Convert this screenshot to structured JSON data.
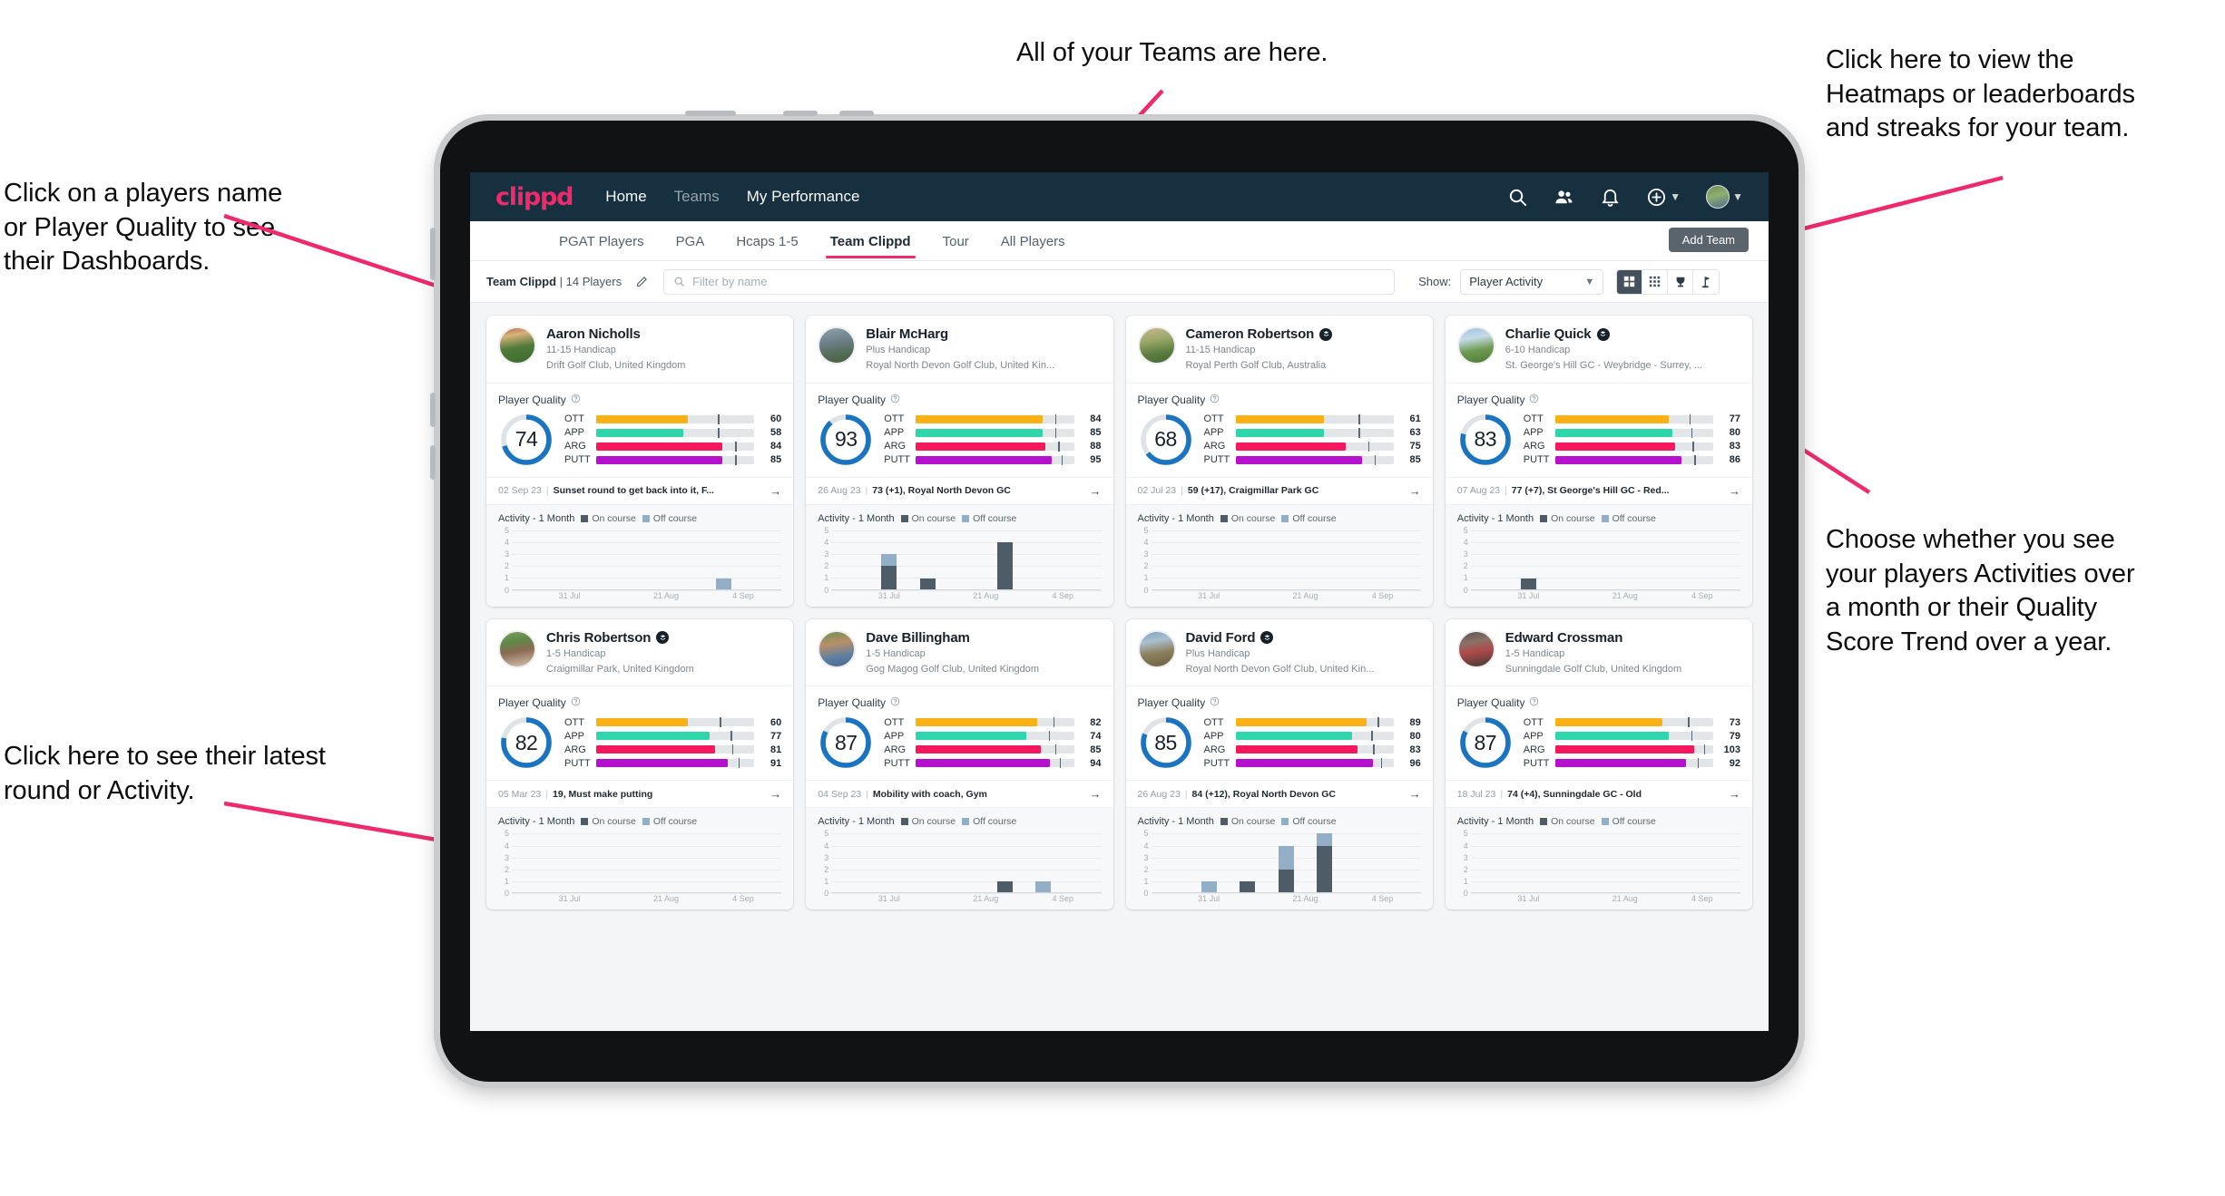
{
  "annotations": [
    {
      "id": "anno-teams",
      "text": "All of your Teams are here."
    },
    {
      "id": "anno-heatmaps",
      "text": "Click here to view the\nHeatmaps or leaderboards\nand streaks for your team."
    },
    {
      "id": "anno-player-name",
      "text": "Click on a players name\nor Player Quality to see\ntheir Dashboards."
    },
    {
      "id": "anno-activity-choice",
      "text": "Choose whether you see\nyour players Activities over\na month or their Quality\nScore Trend over a year."
    },
    {
      "id": "anno-latest-round",
      "text": "Click here to see their latest\nround or Activity."
    }
  ],
  "colors": {
    "brand_pink": "#ee2a6c",
    "navbar": "#17303f",
    "ring": "#1a74c0",
    "ott": "#f9b116",
    "app": "#30d6ab",
    "arg": "#f5records",
    "arg_real": "#f5185f",
    "putt": "#b410cd",
    "on_course": "#4e5c68",
    "off_course": "#93aec7"
  },
  "topnav": {
    "logo": "clippd",
    "links": [
      {
        "label": "Home",
        "active": true
      },
      {
        "label": "Teams",
        "active": false
      },
      {
        "label": "My Performance",
        "active": true
      }
    ],
    "icons": [
      {
        "name": "search-icon"
      },
      {
        "name": "people-icon"
      },
      {
        "name": "bell-icon"
      },
      {
        "name": "plus-circle-icon"
      }
    ],
    "avatar_name": "avatar"
  },
  "subtabs": {
    "items": [
      {
        "label": "PGAT Players",
        "active": false
      },
      {
        "label": "PGA",
        "active": false
      },
      {
        "label": "Hcaps 1-5",
        "active": false
      },
      {
        "label": "Team Clippd",
        "active": true
      },
      {
        "label": "Tour",
        "active": false
      },
      {
        "label": "All Players",
        "active": false
      }
    ],
    "add_team_label": "Add Team"
  },
  "filterbar": {
    "team_name": "Team Clippd",
    "team_count": "| 14 Players",
    "edit_icon": "pencil-icon",
    "search_placeholder": "Filter by name",
    "show_label": "Show:",
    "select_value": "Player Activity",
    "views": [
      {
        "name": "grid-2x2-view",
        "active": true
      },
      {
        "name": "grid-dense-view",
        "active": false
      },
      {
        "name": "trophy-view",
        "active": false
      },
      {
        "name": "flag-view",
        "active": false
      }
    ]
  },
  "card_labels": {
    "player_quality": "Player Quality",
    "activity": "Activity - 1 Month",
    "legend_on": "On course",
    "legend_off": "Off course",
    "metrics": [
      "OTT",
      "APP",
      "ARG",
      "PUTT"
    ]
  },
  "chart_data": {
    "type": "bar",
    "title": "Activity - 1 Month",
    "ylabel": "",
    "xlabel": "",
    "ylim": [
      0,
      5
    ],
    "yticks": [
      0,
      1,
      2,
      3,
      4,
      5
    ],
    "categories": [
      "31 Jul",
      "21 Aug",
      "4 Sep"
    ],
    "legend": [
      "On course",
      "Off course"
    ],
    "legend_position": "top",
    "grid": true,
    "note": "Each card shows a 7-slot stacked bar chart over the date axis 31 Jul / 21 Aug / 4 Sep; per-card values in players[].activity.bars as [on_course, off_course]."
  },
  "players": [
    {
      "name": "Aaron Nicholls",
      "verified": false,
      "handicap": "11-15 Handicap",
      "club": "Drift Golf Club, United Kingdom",
      "avatar": "linear-gradient(170deg,#b06a4e 0%,#d9b27a 22%,#4f7a3a 55%,#3d6b2e 100%)",
      "quality": 74,
      "metrics": [
        {
          "label": "OTT",
          "value": 60,
          "fill": 0.58,
          "tick": 0.77
        },
        {
          "label": "APP",
          "value": 58,
          "fill": 0.55,
          "tick": 0.77
        },
        {
          "label": "ARG",
          "value": 84,
          "fill": 0.8,
          "tick": 0.88
        },
        {
          "label": "PUTT",
          "value": 85,
          "fill": 0.8,
          "tick": 0.88
        }
      ],
      "round": {
        "date": "02 Sep 23",
        "text": "Sunset round to get back into it, F..."
      },
      "activity": {
        "bars": [
          [
            0,
            0
          ],
          [
            0,
            0
          ],
          [
            0,
            0
          ],
          [
            0,
            0
          ],
          [
            0,
            0
          ],
          [
            0,
            1
          ],
          [
            0,
            0
          ]
        ]
      }
    },
    {
      "name": "Blair McHarg",
      "verified": false,
      "handicap": "Plus Handicap",
      "club": "Royal North Devon Golf Club, United Kin...",
      "avatar": "linear-gradient(170deg,#8fa3ad 0%,#6d7f88 40%,#566d5a 70%,#46603a 100%)",
      "quality": 93,
      "metrics": [
        {
          "label": "OTT",
          "value": 84,
          "fill": 0.8,
          "tick": 0.88
        },
        {
          "label": "APP",
          "value": 85,
          "fill": 0.8,
          "tick": 0.88
        },
        {
          "label": "ARG",
          "value": 88,
          "fill": 0.82,
          "tick": 0.9
        },
        {
          "label": "PUTT",
          "value": 95,
          "fill": 0.86,
          "tick": 0.92
        }
      ],
      "round": {
        "date": "26 Aug 23",
        "text": "73 (+1), Royal North Devon GC"
      },
      "activity": {
        "bars": [
          [
            0,
            0
          ],
          [
            2,
            1
          ],
          [
            1,
            0
          ],
          [
            0,
            0
          ],
          [
            4,
            0
          ],
          [
            0,
            0
          ],
          [
            0,
            0
          ]
        ]
      }
    },
    {
      "name": "Cameron Robertson",
      "verified": true,
      "handicap": "11-15 Handicap",
      "club": "Royal Perth Golf Club, Australia",
      "avatar": "linear-gradient(170deg,#c9b68a 0%,#9aa96a 35%,#5c7c40 70%,#476b33 100%)",
      "quality": 68,
      "metrics": [
        {
          "label": "OTT",
          "value": 61,
          "fill": 0.56,
          "tick": 0.78
        },
        {
          "label": "APP",
          "value": 63,
          "fill": 0.56,
          "tick": 0.78
        },
        {
          "label": "ARG",
          "value": 75,
          "fill": 0.7,
          "tick": 0.84
        },
        {
          "label": "PUTT",
          "value": 85,
          "fill": 0.8,
          "tick": 0.88
        }
      ],
      "round": {
        "date": "02 Jul 23",
        "text": "59 (+17), Craigmillar Park GC"
      },
      "activity": {
        "bars": [
          [
            0,
            0
          ],
          [
            0,
            0
          ],
          [
            0,
            0
          ],
          [
            0,
            0
          ],
          [
            0,
            0
          ],
          [
            0,
            0
          ],
          [
            0,
            0
          ]
        ]
      }
    },
    {
      "name": "Charlie Quick",
      "verified": true,
      "handicap": "6-10 Handicap",
      "club": "St. George's Hill GC - Weybridge - Surrey, ...",
      "avatar": "linear-gradient(170deg,#9fc4dd 0%,#c6dbe8 30%,#6f9a52 62%,#4e7a38 100%)",
      "quality": 83,
      "metrics": [
        {
          "label": "OTT",
          "value": 77,
          "fill": 0.72,
          "tick": 0.85
        },
        {
          "label": "APP",
          "value": 80,
          "fill": 0.74,
          "tick": 0.86
        },
        {
          "label": "ARG",
          "value": 83,
          "fill": 0.76,
          "tick": 0.87
        },
        {
          "label": "PUTT",
          "value": 86,
          "fill": 0.8,
          "tick": 0.88
        }
      ],
      "round": {
        "date": "07 Aug 23",
        "text": "77 (+7), St George's Hill GC - Red..."
      },
      "activity": {
        "bars": [
          [
            0,
            0
          ],
          [
            1,
            0
          ],
          [
            0,
            0
          ],
          [
            0,
            0
          ],
          [
            0,
            0
          ],
          [
            0,
            0
          ],
          [
            0,
            0
          ]
        ]
      }
    },
    {
      "name": "Chris Robertson",
      "verified": true,
      "handicap": "1-5 Handicap",
      "club": "Craigmillar Park, United Kingdom",
      "avatar": "linear-gradient(170deg,#7f9e5c 0%,#5f8a48 28%,#8a6a52 55%,#d4c4b0 100%)",
      "quality": 82,
      "metrics": [
        {
          "label": "OTT",
          "value": 60,
          "fill": 0.58,
          "tick": 0.78
        },
        {
          "label": "APP",
          "value": 77,
          "fill": 0.72,
          "tick": 0.85
        },
        {
          "label": "ARG",
          "value": 81,
          "fill": 0.75,
          "tick": 0.86
        },
        {
          "label": "PUTT",
          "value": 91,
          "fill": 0.83,
          "tick": 0.9
        }
      ],
      "round": {
        "date": "05 Mar 23",
        "text": "19, Must make putting"
      },
      "activity": {
        "bars": [
          [
            0,
            0
          ],
          [
            0,
            0
          ],
          [
            0,
            0
          ],
          [
            0,
            0
          ],
          [
            0,
            0
          ],
          [
            0,
            0
          ],
          [
            0,
            0
          ]
        ]
      }
    },
    {
      "name": "Dave Billingham",
      "verified": false,
      "handicap": "1-5 Handicap",
      "club": "Gog Magog Golf Club, United Kingdom",
      "avatar": "linear-gradient(170deg,#6f8f52 0%,#b98f68 35%,#5c7fa3 70%,#46688c 100%)",
      "quality": 87,
      "metrics": [
        {
          "label": "OTT",
          "value": 82,
          "fill": 0.77,
          "tick": 0.87
        },
        {
          "label": "APP",
          "value": 74,
          "fill": 0.7,
          "tick": 0.84
        },
        {
          "label": "ARG",
          "value": 85,
          "fill": 0.79,
          "tick": 0.88
        },
        {
          "label": "PUTT",
          "value": 94,
          "fill": 0.85,
          "tick": 0.91
        }
      ],
      "round": {
        "date": "04 Sep 23",
        "text": "Mobility with coach, Gym"
      },
      "activity": {
        "bars": [
          [
            0,
            0
          ],
          [
            0,
            0
          ],
          [
            0,
            0
          ],
          [
            0,
            0
          ],
          [
            1,
            0
          ],
          [
            0,
            1
          ],
          [
            0,
            0
          ]
        ]
      }
    },
    {
      "name": "David Ford",
      "verified": true,
      "handicap": "Plus Handicap",
      "club": "Royal North Devon Golf Club, United Kin...",
      "avatar": "linear-gradient(170deg,#7fa3bd 0%,#a9c0cf 28%,#8c7f5c 60%,#6b6244 100%)",
      "quality": 85,
      "metrics": [
        {
          "label": "OTT",
          "value": 89,
          "fill": 0.83,
          "tick": 0.9
        },
        {
          "label": "APP",
          "value": 80,
          "fill": 0.74,
          "tick": 0.86
        },
        {
          "label": "ARG",
          "value": 83,
          "fill": 0.77,
          "tick": 0.87
        },
        {
          "label": "PUTT",
          "value": 96,
          "fill": 0.87,
          "tick": 0.92
        }
      ],
      "round": {
        "date": "26 Aug 23",
        "text": "84 (+12), Royal North Devon GC"
      },
      "activity": {
        "bars": [
          [
            0,
            0
          ],
          [
            0,
            1
          ],
          [
            1,
            0
          ],
          [
            2,
            2
          ],
          [
            4,
            1
          ],
          [
            0,
            0
          ],
          [
            0,
            0
          ]
        ]
      }
    },
    {
      "name": "Edward Crossman",
      "verified": false,
      "handicap": "1-5 Handicap",
      "club": "Sunningdale Golf Club, United Kingdom",
      "avatar": "linear-gradient(170deg,#5a5550 0%,#8a7266 30%,#b04a4a 55%,#3e3a36 100%)",
      "quality": 87,
      "metrics": [
        {
          "label": "OTT",
          "value": 73,
          "fill": 0.68,
          "tick": 0.84
        },
        {
          "label": "APP",
          "value": 79,
          "fill": 0.72,
          "tick": 0.86
        },
        {
          "label": "ARG",
          "value": 103,
          "fill": 0.88,
          "tick": 0.94
        },
        {
          "label": "PUTT",
          "value": 92,
          "fill": 0.83,
          "tick": 0.9
        }
      ],
      "round": {
        "date": "18 Jul 23",
        "text": "74 (+4), Sunningdale GC - Old"
      },
      "activity": {
        "bars": [
          [
            0,
            0
          ],
          [
            0,
            0
          ],
          [
            0,
            0
          ],
          [
            0,
            0
          ],
          [
            0,
            0
          ],
          [
            0,
            0
          ],
          [
            0,
            0
          ]
        ]
      }
    }
  ]
}
